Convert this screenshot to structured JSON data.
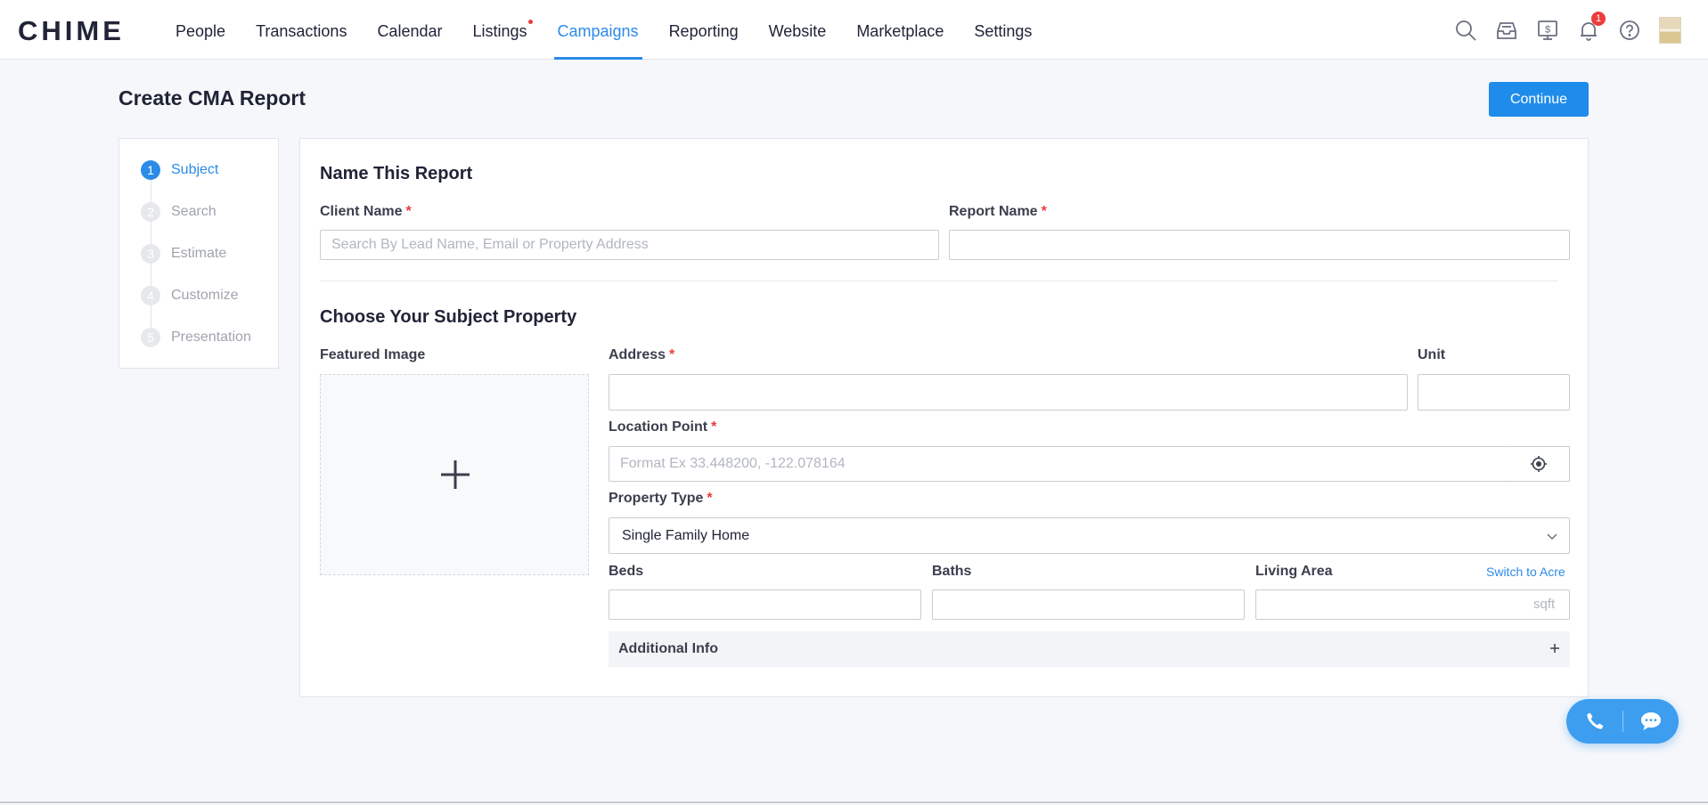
{
  "app": {
    "logo": "CHIME"
  },
  "nav": {
    "items": [
      {
        "label": "People"
      },
      {
        "label": "Transactions"
      },
      {
        "label": "Calendar"
      },
      {
        "label": "Listings"
      },
      {
        "label": "Campaigns"
      },
      {
        "label": "Reporting"
      },
      {
        "label": "Website"
      },
      {
        "label": "Marketplace"
      },
      {
        "label": "Settings"
      }
    ],
    "active": "Campaigns",
    "notification_count": "1"
  },
  "page": {
    "title": "Create CMA Report",
    "continue_label": "Continue"
  },
  "steps": [
    {
      "num": "1",
      "label": "Subject"
    },
    {
      "num": "2",
      "label": "Search"
    },
    {
      "num": "3",
      "label": "Estimate"
    },
    {
      "num": "4",
      "label": "Customize"
    },
    {
      "num": "5",
      "label": "Presentation"
    }
  ],
  "name_section": {
    "title": "Name This Report",
    "client_label": "Client Name",
    "client_placeholder": "Search By Lead Name, Email or Property Address",
    "client_value": "",
    "report_label": "Report Name",
    "report_value": ""
  },
  "property_section": {
    "title": "Choose Your Subject Property",
    "featured_label": "Featured Image",
    "address_label": "Address",
    "unit_label": "Unit",
    "location_label": "Location Point",
    "location_placeholder": "Format Ex 33.448200, -122.078164",
    "type_label": "Property Type",
    "type_value": "Single Family Home",
    "beds_label": "Beds",
    "baths_label": "Baths",
    "living_label": "Living Area",
    "switch_label": "Switch to Acre",
    "living_unit": "sqft",
    "additional_label": "Additional Info"
  },
  "required_mark": "*",
  "colors": {
    "accent": "#2c8be8",
    "required": "#ec3c3c",
    "float_bg": "#3d9ef0"
  }
}
